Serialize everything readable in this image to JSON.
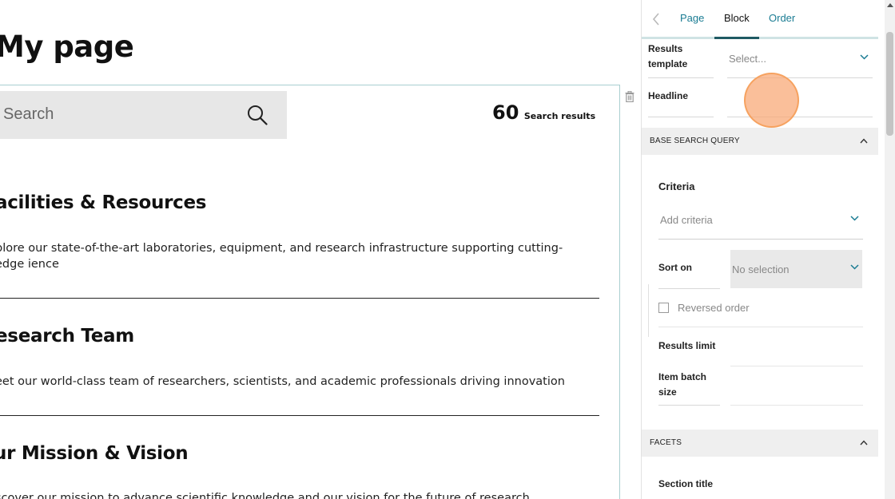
{
  "page": {
    "title": "My page",
    "search": {
      "placeholder": "Search"
    },
    "results": {
      "count": "60",
      "label": "Search results"
    },
    "items": [
      {
        "title": "acilities & Resources",
        "description": "plore our state-of-the-art laboratories, equipment, and research infrastructure supporting cutting-edge ience"
      },
      {
        "title": "esearch Team",
        "description": "eet our world-class team of researchers, scientists, and academic professionals driving innovation"
      },
      {
        "title": "ur Mission & Vision",
        "description": "scover our mission to advance scientific knowledge and our vision for the future of research"
      }
    ]
  },
  "panel": {
    "tabs": {
      "page": "Page",
      "block": "Block",
      "order": "Order"
    },
    "results_template": {
      "label": "Results template",
      "value": "Select..."
    },
    "headline": {
      "label": "Headline"
    },
    "base_search_query": {
      "title": "BASE SEARCH QUERY",
      "criteria_heading": "Criteria",
      "add_criteria": "Add criteria",
      "sort_on_label": "Sort on",
      "sort_on_value": "No selection",
      "reversed_order": "Reversed order",
      "results_limit": "Results limit",
      "item_batch_size": "Item batch size"
    },
    "facets": {
      "title": "FACETS",
      "section_title": "Section title"
    }
  },
  "colors": {
    "accent": "#1a7c93",
    "tab_active": "#1f5a63",
    "frame": "#a9cfd0",
    "cursor": "#f8aa78"
  }
}
